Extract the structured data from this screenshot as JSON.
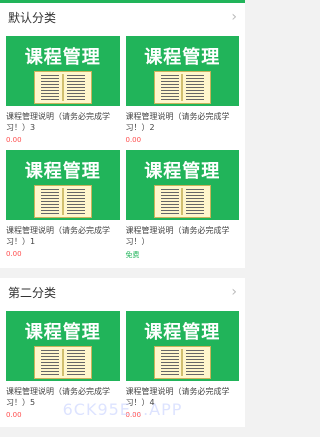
{
  "sections": [
    {
      "title": "默认分类",
      "items": [
        {
          "thumb_title": "课程管理",
          "title": "课程管理说明（请务必完成学习！）3",
          "price": "0.00"
        },
        {
          "thumb_title": "课程管理",
          "title": "课程管理说明（请务必完成学习！）2",
          "price": "0.00"
        },
        {
          "thumb_title": "课程管理",
          "title": "课程管理说明（请务必完成学习！）1",
          "price": "0.00"
        },
        {
          "thumb_title": "课程管理",
          "title": "课程管理说明（请务必完成学习！）",
          "price": "免费"
        }
      ]
    },
    {
      "title": "第二分类",
      "items": [
        {
          "thumb_title": "课程管理",
          "title": "课程管理说明（请务必完成学习！）5",
          "price": "0.00"
        },
        {
          "thumb_title": "课程管理",
          "title": "课程管理说明（请务必完成学习！）4",
          "price": "0.00"
        }
      ]
    }
  ],
  "watermark": "6CK95E...APP",
  "colors": {
    "brand": "#21b45a",
    "price_red": "#ff4d4d",
    "free_green": "#20b45a"
  }
}
